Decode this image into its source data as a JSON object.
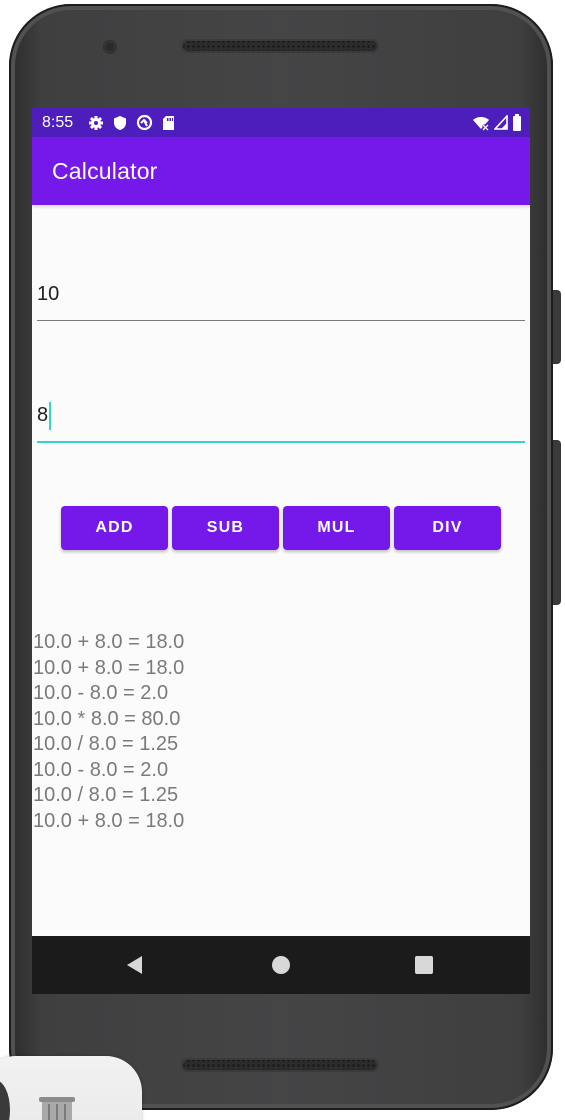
{
  "status_bar": {
    "time": "8:55",
    "left_icons": [
      "gear-icon",
      "shield-icon",
      "sync-icon",
      "sd-card-icon"
    ],
    "right_icons": [
      "wifi-icon",
      "signal-icon",
      "battery-icon"
    ],
    "color": "#4e1ebd"
  },
  "app_bar": {
    "title": "Calculator",
    "color": "#7518ea"
  },
  "inputs": {
    "first_value": "10",
    "second_value": "8"
  },
  "buttons": [
    {
      "label": "ADD"
    },
    {
      "label": "SUB"
    },
    {
      "label": "MUL"
    },
    {
      "label": "DIV"
    }
  ],
  "history": [
    "10.0 + 8.0 = 18.0",
    "10.0 + 8.0 = 18.0",
    "10.0 - 8.0 = 2.0",
    "10.0 * 8.0 = 80.0",
    "10.0 / 8.0 = 1.25",
    "10.0 - 8.0 = 2.0",
    "10.0 / 8.0 = 1.25",
    "10.0 + 8.0 = 18.0"
  ],
  "nav_bar": {
    "icons": [
      "back-icon",
      "home-icon",
      "recents-icon"
    ]
  },
  "colors": {
    "accent": "#7518ea",
    "focus_underline": "#32d6c8"
  }
}
